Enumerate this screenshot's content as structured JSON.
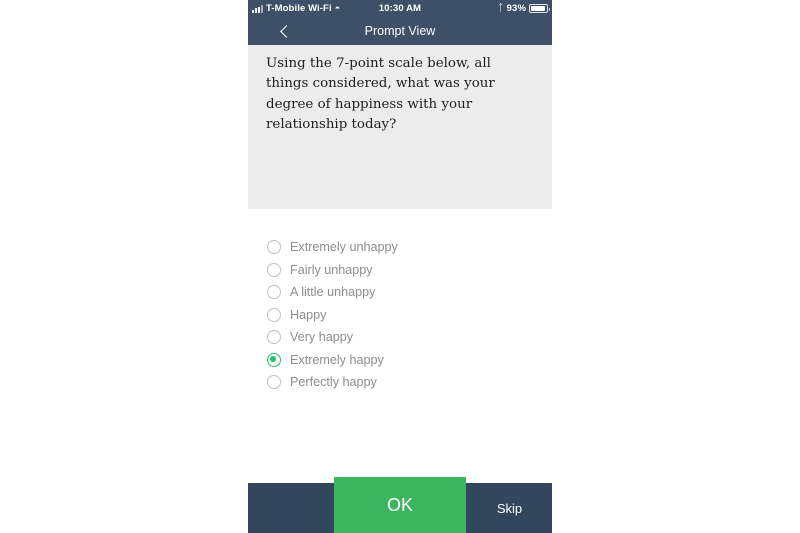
{
  "status_bar": {
    "signal_icon": "signal-bars-icon",
    "carrier": "T-Mobile Wi-Fi",
    "wifi_icon": "wifi-icon",
    "time": "10:30 AM",
    "bluetooth_icon": "bluetooth-icon",
    "battery_percent": "93%",
    "battery_icon": "battery-icon"
  },
  "nav_bar": {
    "back_icon": "chevron-left-icon",
    "title": "Prompt View"
  },
  "prompt": {
    "text": "Using the 7-point scale below, all things considered, what was your degree of happiness with your relationship today?"
  },
  "options": {
    "selected_index": 5,
    "items": [
      {
        "label": "Extremely unhappy",
        "selected": false
      },
      {
        "label": "Fairly unhappy",
        "selected": false
      },
      {
        "label": "A little unhappy",
        "selected": false
      },
      {
        "label": "Happy",
        "selected": false
      },
      {
        "label": "Very happy",
        "selected": false
      },
      {
        "label": "Extremely happy",
        "selected": true
      },
      {
        "label": "Perfectly happy",
        "selected": false
      }
    ]
  },
  "actions": {
    "ok_label": "OK",
    "skip_label": "Skip"
  },
  "colors": {
    "nav_bg": "#3d5068",
    "bottom_bar_bg": "#32465d",
    "accent_green": "#3cb561",
    "radio_green": "#22c06a",
    "card_bg": "#ececec",
    "label_gray": "#8d8d8d"
  }
}
